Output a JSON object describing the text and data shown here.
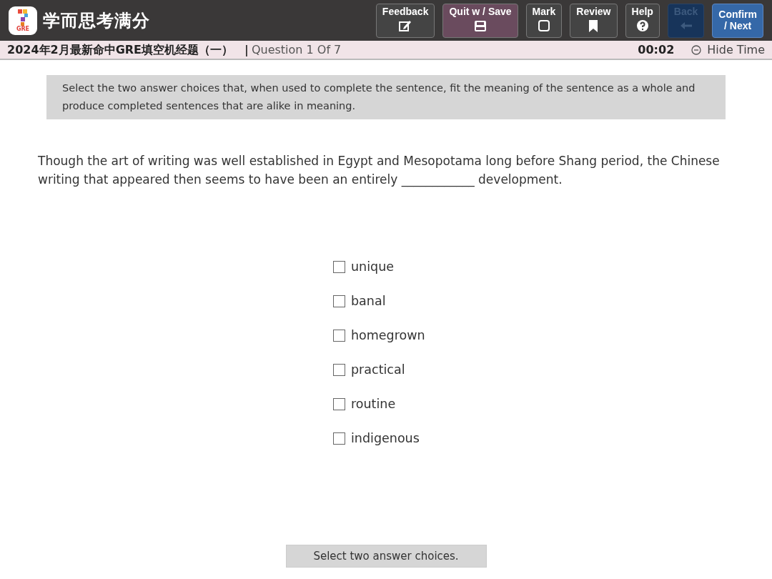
{
  "app": {
    "logo_badge": "GRE",
    "title": "学而思考满分"
  },
  "toolbar": [
    {
      "label": "Feedback",
      "kind": "normal",
      "disabled": false
    },
    {
      "label": "Quit w / Save",
      "kind": "quit",
      "disabled": false
    },
    {
      "label": "Mark",
      "kind": "normal",
      "disabled": false
    },
    {
      "label": "Review",
      "kind": "normal",
      "disabled": false
    },
    {
      "label": "Help",
      "kind": "normal",
      "disabled": false
    },
    {
      "label": "Back",
      "kind": "nav",
      "disabled": true
    },
    {
      "label": "Confirm\n/ Next",
      "kind": "nav",
      "disabled": false
    }
  ],
  "status_bar": {
    "section": "2024年2月最新命中GRE填空机经题（一）",
    "separator": "|",
    "progress": "Question 1 Of 7",
    "timer": "00:02",
    "timer_toggle": "Hide Time"
  },
  "instructions": "Select the two answer choices that, when used to complete the sentence, fit the meaning of the sentence as a whole and produce completed sentences that are alike in meaning.",
  "question": "Though the art of writing was well established in Egypt and Mesopotama long before Shang period, the Chinese writing that appeared then seems to have been an entirely ____________ development.",
  "choices": [
    {
      "label": "unique",
      "checked": false
    },
    {
      "label": "banal",
      "checked": false
    },
    {
      "label": "homegrown",
      "checked": false
    },
    {
      "label": "practical",
      "checked": false
    },
    {
      "label": "routine",
      "checked": false
    },
    {
      "label": "indigenous",
      "checked": false
    }
  ],
  "footer_hint": "Select two answer choices."
}
